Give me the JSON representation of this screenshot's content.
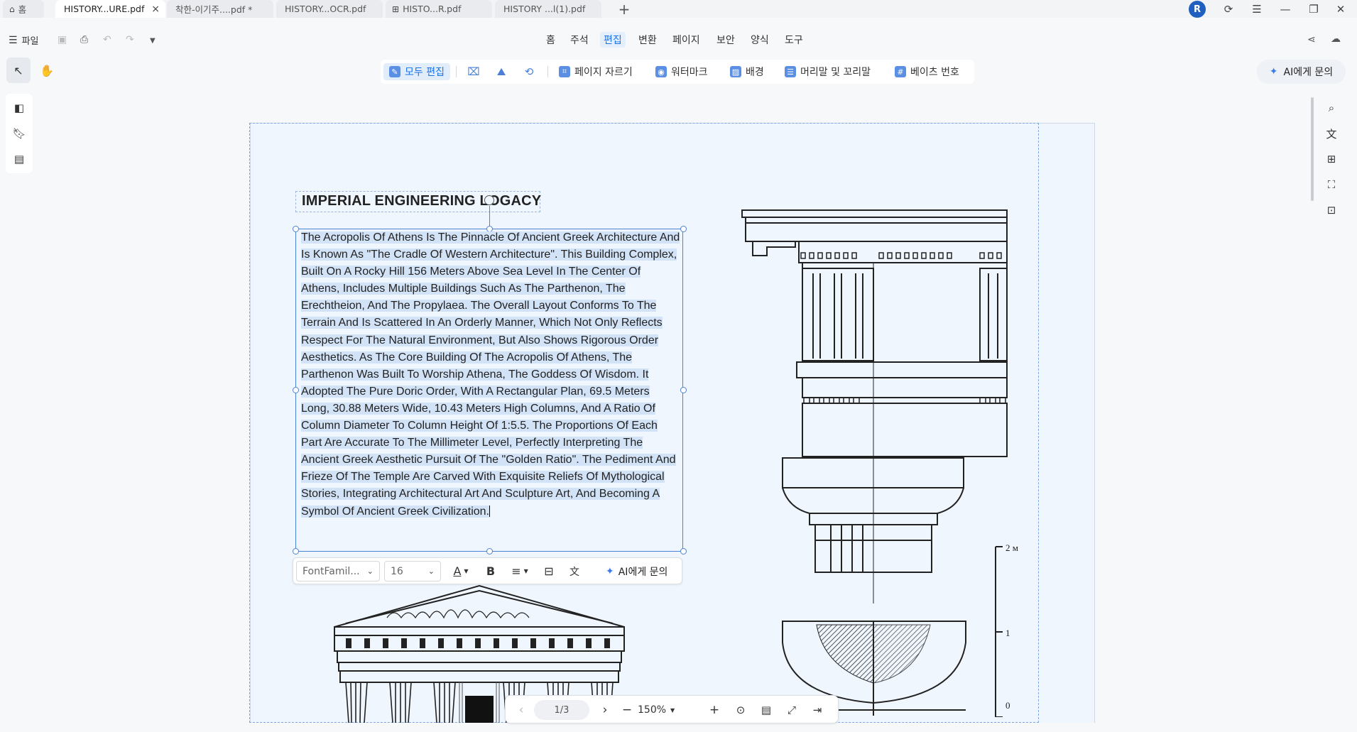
{
  "tabs": [
    {
      "label": "홈",
      "icon": "home-icon"
    },
    {
      "label": "HISTORY...URE.pdf",
      "active": true,
      "closable": true
    },
    {
      "label": "착한-이기주....pdf *"
    },
    {
      "label": "HISTORY...OCR.pdf"
    },
    {
      "label": "HISTO...R.pdf",
      "icon": "pdf-grid-icon"
    },
    {
      "label": "HISTORY ...l(1).pdf"
    }
  ],
  "user_initial": "R",
  "file_menu": {
    "label": "파일"
  },
  "main_menu": [
    "홈",
    "주석",
    "편집",
    "변환",
    "페이지",
    "보안",
    "양식",
    "도구"
  ],
  "active_menu": "편집",
  "edit_toolbar": {
    "edit_all": "모두 편집",
    "crop": "페이지 자르기",
    "watermark": "워터마크",
    "background": "배경",
    "header_footer": "머리말 및 꼬리말",
    "bates": "베이츠 번호"
  },
  "ai_button": "AI에게 문의",
  "document": {
    "title": "IMPERIAL ENGINEERING LOGACY",
    "body": "The Acropolis Of Athens Is The Pinnacle Of Ancient Greek Architecture And Is Known As \"The Cradle Of Western Architecture\". This Building Complex, Built On A Rocky Hill 156 Meters Above Sea Level In The Center Of Athens, Includes Multiple Buildings Such As The Parthenon, The Erechtheion, And The Propylaea. The Overall Layout Conforms To The Terrain And Is Scattered In An Orderly Manner, Which Not Only Reflects Respect For The Natural Environment, But Also Shows Rigorous Order Aesthetics. As The Core Building Of The Acropolis Of Athens, The Parthenon Was Built To Worship Athena, The Goddess Of Wisdom. It Adopted The Pure Doric Order, With A Rectangular Plan, 69.5 Meters Long, 30.88 Meters Wide, 10.43 Meters High Columns, And A Ratio Of Column Diameter To Column Height Of 1:5.5. The Proportions Of Each Part Are Accurate To The Millimeter Level, Perfectly Interpreting The Ancient Greek Aesthetic Pursuit Of The \"Golden Ratio\". The Pediment And Frieze Of The Temple Are Carved With Exquisite Reliefs Of Mythological Stories, Integrating Architectural Art And Sculpture Art, And Becoming A Symbol Of Ancient Greek Civilization.",
    "scale_labels": [
      "2 м",
      "1",
      "0"
    ]
  },
  "format_bar": {
    "font_family": "FontFamil...",
    "font_size": "16",
    "ai_label": "AI에게 문의"
  },
  "navigation": {
    "page": "1/3",
    "zoom": "150%"
  },
  "colors": {
    "accent": "#1a73e8",
    "selection": "#d3e3f7",
    "page_bg": "#f0f6fe",
    "avatar": "#1f5fbf"
  }
}
